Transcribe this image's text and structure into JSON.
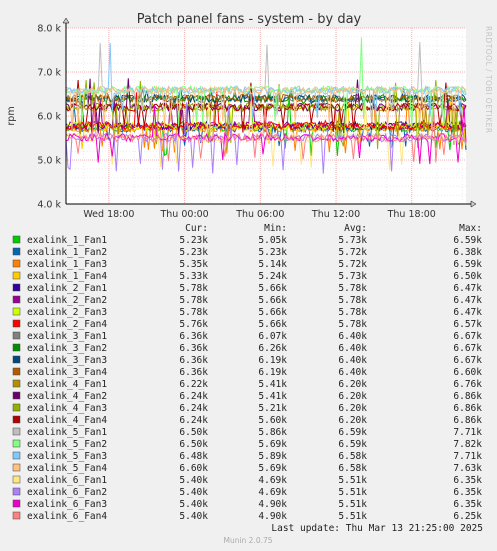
{
  "chart_data": {
    "type": "line",
    "title": "Patch panel fans - system - by day",
    "ylabel": "rpm",
    "ylim": [
      4000,
      8000
    ],
    "y_ticks": [
      {
        "value": 4000,
        "label": "4.0 k"
      },
      {
        "value": 5000,
        "label": "5.0 k"
      },
      {
        "value": 6000,
        "label": "6.0 k"
      },
      {
        "value": 7000,
        "label": "7.0 k"
      },
      {
        "value": 8000,
        "label": "8.0 k"
      }
    ],
    "x_range_hours": [
      -3.4,
      28.3
    ],
    "x_ticks": [
      {
        "hour": 0,
        "label": "Wed 18:00"
      },
      {
        "hour": 6,
        "label": "Thu 00:00"
      },
      {
        "hour": 12,
        "label": "Thu 06:00"
      },
      {
        "hour": 18,
        "label": "Thu 12:00"
      },
      {
        "hour": 24,
        "label": "Thu 18:00"
      }
    ],
    "grid": true,
    "legend_headers": {
      "cur": "Cur:",
      "min": "Min:",
      "avg": "Avg:",
      "max": "Max:"
    },
    "series": [
      {
        "name": "exalink_1_Fan1",
        "color": "#00cc00",
        "cur": "5.23k",
        "min": "5.05k",
        "avg": "5.73k",
        "max": "6.59k",
        "c": 5.23,
        "mn": 5.05,
        "av": 5.73,
        "mx": 6.59
      },
      {
        "name": "exalink_1_Fan2",
        "color": "#0066b3",
        "cur": "5.23k",
        "min": "5.23k",
        "avg": "5.72k",
        "max": "6.38k",
        "c": 5.23,
        "mn": 5.23,
        "av": 5.72,
        "mx": 6.38
      },
      {
        "name": "exalink_1_Fan3",
        "color": "#ff8000",
        "cur": "5.35k",
        "min": "5.14k",
        "avg": "5.72k",
        "max": "6.59k",
        "c": 5.35,
        "mn": 5.14,
        "av": 5.72,
        "mx": 6.59
      },
      {
        "name": "exalink_1_Fan4",
        "color": "#ffcc00",
        "cur": "5.33k",
        "min": "5.24k",
        "avg": "5.73k",
        "max": "6.50k",
        "c": 5.33,
        "mn": 5.24,
        "av": 5.73,
        "mx": 6.5
      },
      {
        "name": "exalink_2_Fan1",
        "color": "#330099",
        "cur": "5.78k",
        "min": "5.66k",
        "avg": "5.78k",
        "max": "6.47k",
        "c": 5.78,
        "mn": 5.66,
        "av": 5.78,
        "mx": 6.47
      },
      {
        "name": "exalink_2_Fan2",
        "color": "#990099",
        "cur": "5.78k",
        "min": "5.66k",
        "avg": "5.78k",
        "max": "6.47k",
        "c": 5.78,
        "mn": 5.66,
        "av": 5.78,
        "mx": 6.47
      },
      {
        "name": "exalink_2_Fan3",
        "color": "#ccff00",
        "cur": "5.78k",
        "min": "5.66k",
        "avg": "5.78k",
        "max": "6.47k",
        "c": 5.78,
        "mn": 5.66,
        "av": 5.78,
        "mx": 6.47
      },
      {
        "name": "exalink_2_Fan4",
        "color": "#ff0000",
        "cur": "5.76k",
        "min": "5.66k",
        "avg": "5.78k",
        "max": "6.57k",
        "c": 5.76,
        "mn": 5.66,
        "av": 5.78,
        "mx": 6.57
      },
      {
        "name": "exalink_3_Fan1",
        "color": "#808080",
        "cur": "6.36k",
        "min": "6.07k",
        "avg": "6.40k",
        "max": "6.67k",
        "c": 6.36,
        "mn": 6.07,
        "av": 6.4,
        "mx": 6.67
      },
      {
        "name": "exalink_3_Fan2",
        "color": "#008f00",
        "cur": "6.36k",
        "min": "6.26k",
        "avg": "6.40k",
        "max": "6.67k",
        "c": 6.36,
        "mn": 6.26,
        "av": 6.4,
        "mx": 6.67
      },
      {
        "name": "exalink_3_Fan3",
        "color": "#00487d",
        "cur": "6.36k",
        "min": "6.19k",
        "avg": "6.40k",
        "max": "6.67k",
        "c": 6.36,
        "mn": 6.19,
        "av": 6.4,
        "mx": 6.67
      },
      {
        "name": "exalink_3_Fan4",
        "color": "#b35a00",
        "cur": "6.36k",
        "min": "6.19k",
        "avg": "6.40k",
        "max": "6.60k",
        "c": 6.36,
        "mn": 6.19,
        "av": 6.4,
        "mx": 6.6
      },
      {
        "name": "exalink_4_Fan1",
        "color": "#b38f00",
        "cur": "6.22k",
        "min": "5.41k",
        "avg": "6.20k",
        "max": "6.76k",
        "c": 6.22,
        "mn": 5.41,
        "av": 6.2,
        "mx": 6.76
      },
      {
        "name": "exalink_4_Fan2",
        "color": "#6b006b",
        "cur": "6.24k",
        "min": "5.41k",
        "avg": "6.20k",
        "max": "6.86k",
        "c": 6.24,
        "mn": 5.41,
        "av": 6.2,
        "mx": 6.86
      },
      {
        "name": "exalink_4_Fan3",
        "color": "#8fb300",
        "cur": "6.24k",
        "min": "5.21k",
        "avg": "6.20k",
        "max": "6.86k",
        "c": 6.24,
        "mn": 5.21,
        "av": 6.2,
        "mx": 6.86
      },
      {
        "name": "exalink_4_Fan4",
        "color": "#b30000",
        "cur": "6.24k",
        "min": "5.60k",
        "avg": "6.20k",
        "max": "6.86k",
        "c": 6.24,
        "mn": 5.6,
        "av": 6.2,
        "mx": 6.86
      },
      {
        "name": "exalink_5_Fan1",
        "color": "#bebebe",
        "cur": "6.50k",
        "min": "5.86k",
        "avg": "6.59k",
        "max": "7.71k",
        "c": 6.5,
        "mn": 5.86,
        "av": 6.59,
        "mx": 7.71
      },
      {
        "name": "exalink_5_Fan2",
        "color": "#80ff80",
        "cur": "6.50k",
        "min": "5.69k",
        "avg": "6.59k",
        "max": "7.82k",
        "c": 6.5,
        "mn": 5.69,
        "av": 6.59,
        "mx": 7.82
      },
      {
        "name": "exalink_5_Fan3",
        "color": "#80c9ff",
        "cur": "6.48k",
        "min": "5.89k",
        "avg": "6.58k",
        "max": "7.71k",
        "c": 6.48,
        "mn": 5.89,
        "av": 6.58,
        "mx": 7.71
      },
      {
        "name": "exalink_5_Fan4",
        "color": "#ffc080",
        "cur": "6.60k",
        "min": "5.69k",
        "avg": "6.58k",
        "max": "7.63k",
        "c": 6.6,
        "mn": 5.69,
        "av": 6.58,
        "mx": 7.63
      },
      {
        "name": "exalink_6_Fan1",
        "color": "#ffe680",
        "cur": "5.40k",
        "min": "4.69k",
        "avg": "5.51k",
        "max": "6.35k",
        "c": 5.4,
        "mn": 4.69,
        "av": 5.51,
        "mx": 6.35
      },
      {
        "name": "exalink_6_Fan2",
        "color": "#aa80ff",
        "cur": "5.40k",
        "min": "4.69k",
        "avg": "5.51k",
        "max": "6.35k",
        "c": 5.4,
        "mn": 4.69,
        "av": 5.51,
        "mx": 6.35
      },
      {
        "name": "exalink_6_Fan3",
        "color": "#ee00cc",
        "cur": "5.40k",
        "min": "4.90k",
        "avg": "5.51k",
        "max": "6.35k",
        "c": 5.4,
        "mn": 4.9,
        "av": 5.51,
        "mx": 6.35
      },
      {
        "name": "exalink_6_Fan4",
        "color": "#ff8080",
        "cur": "5.40k",
        "min": "4.90k",
        "avg": "5.51k",
        "max": "6.25k",
        "c": 5.4,
        "mn": 4.9,
        "av": 5.51,
        "mx": 6.25
      }
    ]
  },
  "footer": {
    "last_update": "Last update: Thu Mar 13 21:25:00 2025",
    "version": "Munin 2.0.75"
  },
  "side_text": "RRDTOOL / TOBI OETIKER"
}
